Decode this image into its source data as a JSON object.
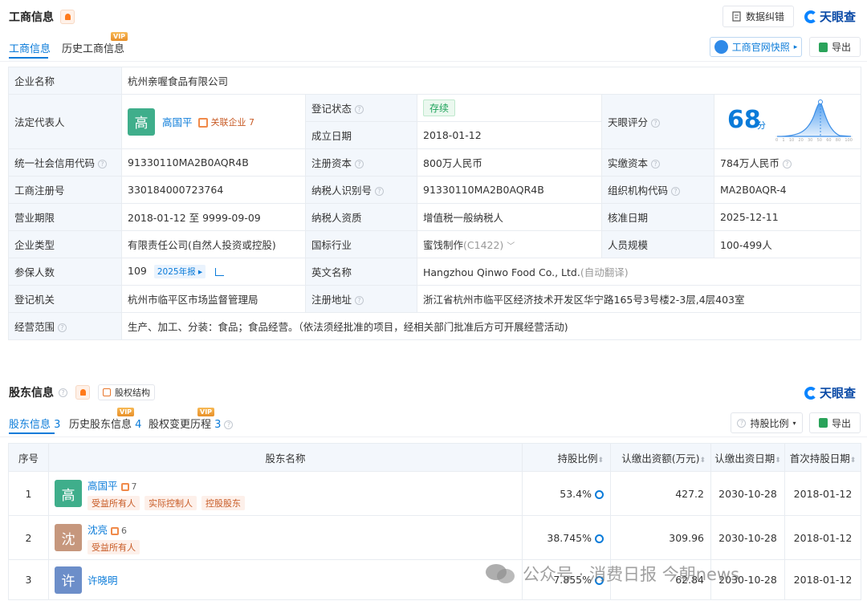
{
  "biz_section": {
    "title": "工商信息",
    "btn_correction": "数据纠错",
    "logo_text": "天眼查",
    "tabs": [
      {
        "label": "工商信息",
        "vip": ""
      },
      {
        "label": "历史工商信息",
        "vip": "VIP"
      }
    ],
    "btn_snapshot": "工商官网快照",
    "btn_export": "导出"
  },
  "info": {
    "company_name_k": "企业名称",
    "company_name_v": "杭州亲喔食品有限公司",
    "legal_rep_k": "法定代表人",
    "legal_rep_avatar": "高",
    "legal_rep_name": "高国平",
    "legal_rep_related": "关联企业",
    "legal_rep_related_count": "7",
    "reg_status_k": "登记状态",
    "reg_status_v": "存续",
    "est_date_k": "成立日期",
    "est_date_v": "2018-01-12",
    "score_k": "天眼评分",
    "score_v": "68",
    "score_unit": "分",
    "score_ticks": [
      "0",
      "1",
      "10",
      "20",
      "30",
      "50",
      "60",
      "80",
      "100"
    ],
    "credit_code_k": "统一社会信用代码",
    "credit_code_v": "91330110MA2B0AQR4B",
    "reg_capital_k": "注册资本",
    "reg_capital_v": "800万人民币",
    "paid_capital_k": "实缴资本",
    "paid_capital_v": "784万人民币",
    "reg_no_k": "工商注册号",
    "reg_no_v": "330184000723764",
    "tax_id_k": "纳税人识别号",
    "tax_id_v": "91330110MA2B0AQR4B",
    "org_code_k": "组织机构代码",
    "org_code_v": "MA2B0AQR-4",
    "term_k": "营业期限",
    "term_v": "2018-01-12 至 9999-09-09",
    "tax_qual_k": "纳税人资质",
    "tax_qual_v": "增值税一般纳税人",
    "approve_date_k": "核准日期",
    "approve_date_v": "2025-12-11",
    "type_k": "企业类型",
    "type_v": "有限责任公司(自然人投资或控股)",
    "industry_k": "国标行业",
    "industry_v": "蜜饯制作",
    "industry_code": "(C1422)",
    "staff_k": "人员规模",
    "staff_v": "100-499人",
    "insured_k": "参保人数",
    "insured_v": "109",
    "insured_report": "2025年报",
    "en_name_k": "英文名称",
    "en_name_v": "Hangzhou Qinwo Food Co., Ltd.",
    "en_name_note": "(自动翻译)",
    "authority_k": "登记机关",
    "authority_v": "杭州市临平区市场监督管理局",
    "address_k": "注册地址",
    "address_v": "浙江省杭州市临平区经济技术开发区华宁路165号3号楼2-3层,4层403室",
    "scope_k": "经营范围",
    "scope_v": "生产、加工、分装：食品；食品经营。（依法须经批准的项目，经相关部门批准后方可开展经营活动)"
  },
  "sh_section": {
    "title": "股东信息",
    "btn_structure": "股权结构",
    "logo_text": "天眼查",
    "tabs": [
      {
        "label": "股东信息",
        "count": "3",
        "vip": ""
      },
      {
        "label": "历史股东信息",
        "count": "4",
        "vip": "VIP"
      },
      {
        "label": "股权变更历程",
        "count": "3",
        "vip": "VIP"
      }
    ],
    "btn_ratio": "持股比例",
    "btn_export": "导出",
    "headers": [
      "序号",
      "股东名称",
      "持股比例",
      "认缴出资额(万元)",
      "认缴出资日期",
      "首次持股日期"
    ],
    "rows": [
      {
        "no": "1",
        "avatar": "高",
        "name": "高国平",
        "rel": "7",
        "tags": [
          "受益所有人",
          "实际控制人",
          "控股股东"
        ],
        "ratio": "53.4%",
        "amount": "427.2",
        "sub_date": "2030-10-28",
        "first_date": "2018-01-12"
      },
      {
        "no": "2",
        "avatar": "沈",
        "name": "沈亮",
        "rel": "6",
        "tags": [
          "受益所有人"
        ],
        "ratio": "38.745%",
        "amount": "309.96",
        "sub_date": "2030-10-28",
        "first_date": "2018-01-12"
      },
      {
        "no": "3",
        "avatar": "许",
        "name": "许晓明",
        "rel": "",
        "tags": [],
        "ratio": "7.855%",
        "amount": "62.84",
        "sub_date": "2030-10-28",
        "first_date": "2018-01-12"
      }
    ]
  },
  "watermark": "公众号 · 消费日报 今朝news",
  "colors": {
    "accent": "#0a7bd9",
    "avatar_gao": "#3fae8b",
    "avatar_shen": "#c6977d",
    "avatar_xu": "#6c8ec9"
  }
}
